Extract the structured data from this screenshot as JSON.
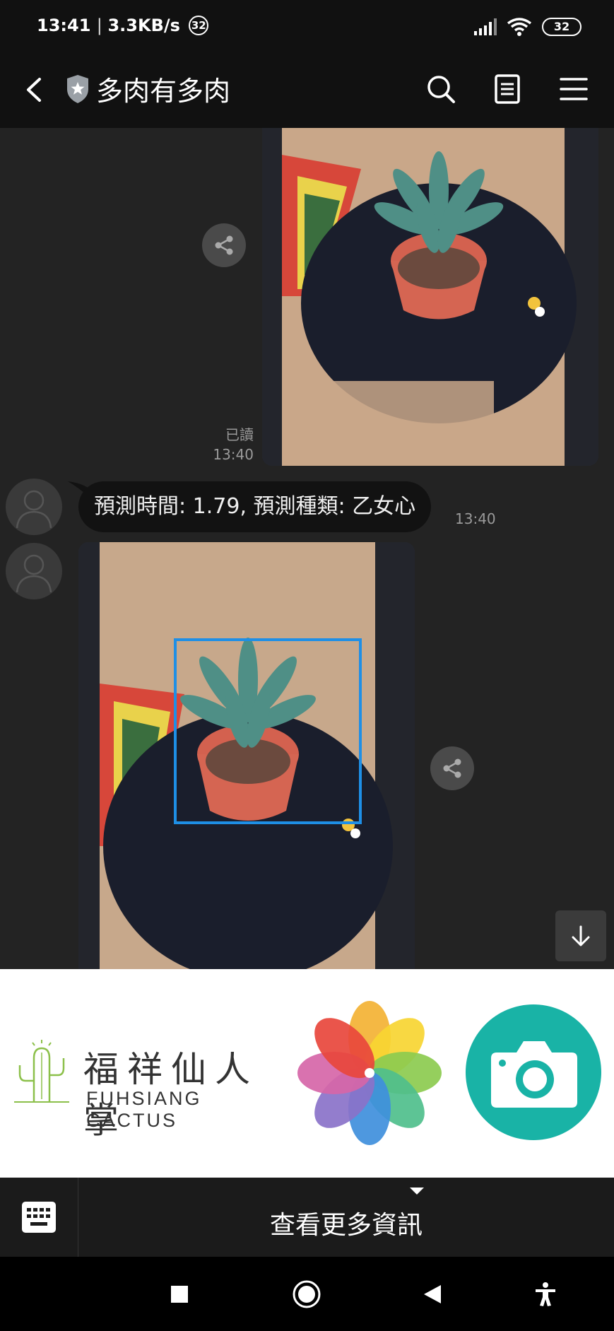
{
  "status_bar": {
    "time": "13:41",
    "network_speed": "3.3KB/s",
    "notification_count": "32",
    "battery": "32"
  },
  "header": {
    "title": "多肉有多肉"
  },
  "chat": {
    "messages": [
      {
        "type": "image",
        "sender": "me",
        "read_label": "已讀",
        "time": "13:40"
      },
      {
        "type": "text",
        "sender": "bot",
        "text": "預測時間: 1.79, 預測種類: 乙女心",
        "time": "13:40"
      },
      {
        "type": "image",
        "sender": "bot"
      }
    ]
  },
  "rich_menu": {
    "brand_name_cn": "福祥仙人掌",
    "brand_name_en": "FUHSIANG CACTUS"
  },
  "menu_bar": {
    "toggle_label": "查看更多資訊"
  },
  "colors": {
    "detection_box": "#1e8fe6",
    "camera_button": "#19b3a6"
  }
}
